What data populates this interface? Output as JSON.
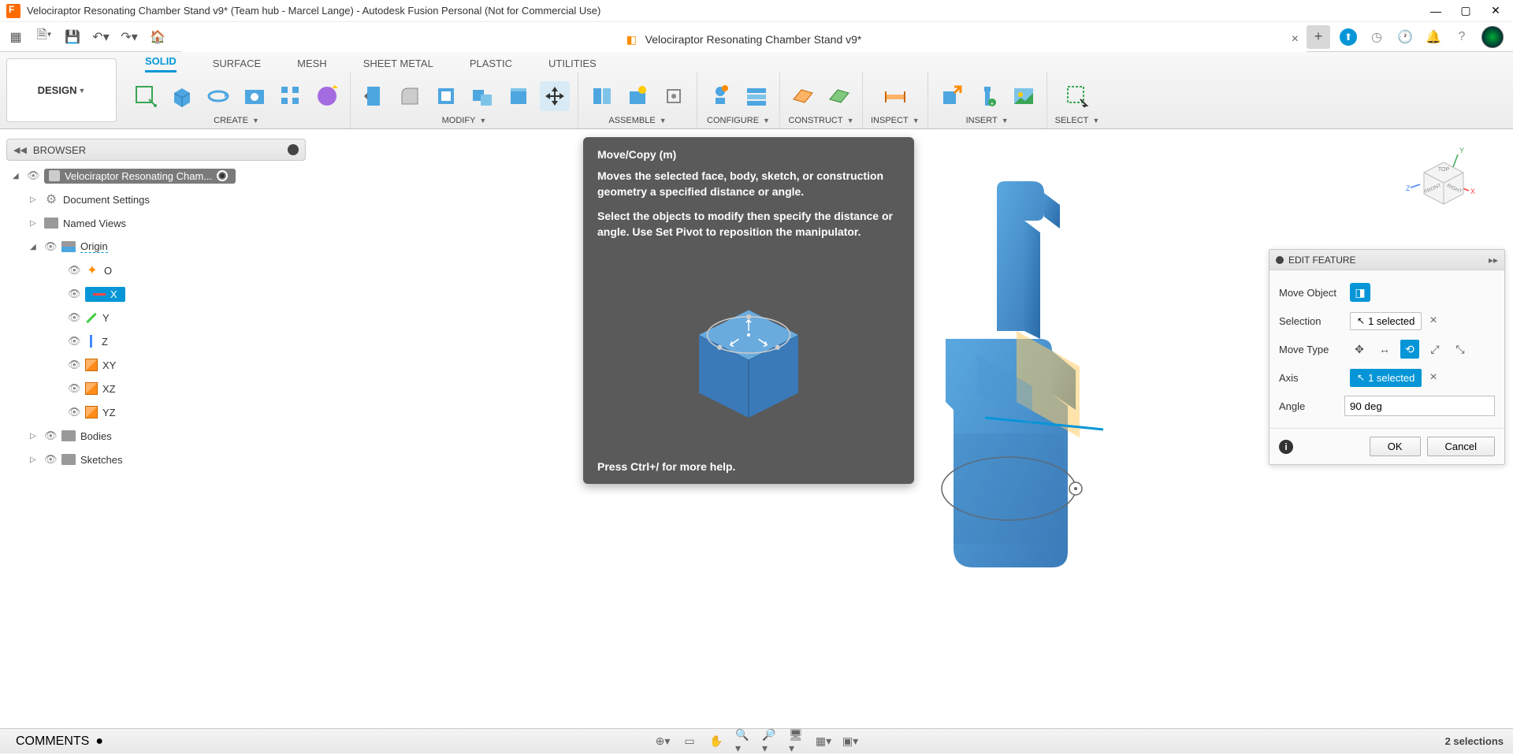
{
  "titlebar": {
    "text": "Velociraptor Resonating Chamber Stand v9* (Team hub - Marcel Lange) - Autodesk Fusion Personal (Not for Commercial Use)"
  },
  "qat": {
    "docTab": "Velociraptor Resonating Chamber Stand v9*"
  },
  "ribbon": {
    "design": "DESIGN",
    "tabs": [
      "SOLID",
      "SURFACE",
      "MESH",
      "SHEET METAL",
      "PLASTIC",
      "UTILITIES"
    ],
    "groups": [
      "CREATE",
      "MODIFY",
      "ASSEMBLE",
      "CONFIGURE",
      "CONSTRUCT",
      "INSPECT",
      "INSERT",
      "SELECT"
    ]
  },
  "browser": {
    "title": "BROWSER",
    "root": "Velociraptor Resonating Cham...",
    "items": {
      "docSettings": "Document Settings",
      "namedViews": "Named Views",
      "origin": "Origin",
      "O": "O",
      "X": "X",
      "Y": "Y",
      "Z": "Z",
      "XY": "XY",
      "XZ": "XZ",
      "YZ": "YZ",
      "bodies": "Bodies",
      "sketches": "Sketches"
    }
  },
  "tooltip": {
    "title": "Move/Copy (m)",
    "p1": "Moves the selected face, body, sketch, or construction geometry a specified distance or angle.",
    "p2": "Select the objects to modify then specify the distance or angle. Use Set Pivot to reposition the manipulator.",
    "footer": "Press Ctrl+/ for more help."
  },
  "panel": {
    "title": "EDIT FEATURE",
    "moveObject": "Move Object",
    "selection": "Selection",
    "selectionVal": "1 selected",
    "moveType": "Move Type",
    "axis": "Axis",
    "axisVal": "1 selected",
    "angle": "Angle",
    "angleVal": "90 deg",
    "ok": "OK",
    "cancel": "Cancel"
  },
  "statusbar": {
    "comments": "COMMENTS",
    "selections": "2 selections"
  },
  "viewcube": {
    "top": "TOP",
    "front": "FRONT",
    "right": "RIGHT"
  }
}
